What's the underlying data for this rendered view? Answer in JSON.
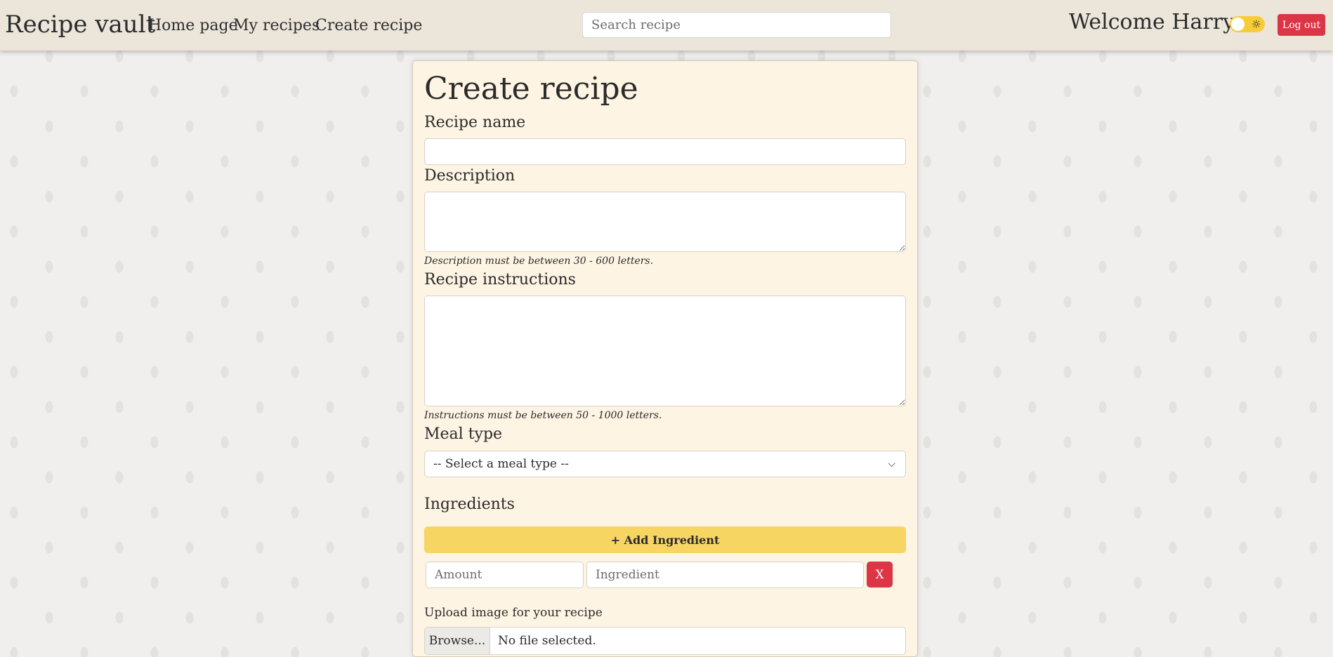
{
  "nav": {
    "brand": "Recipe vault",
    "links": [
      "Home page",
      "My recipes",
      "Create recipe"
    ],
    "search_placeholder": "Search recipe",
    "welcome": "Welcome Harry",
    "theme_toggle_icon": "sun-icon",
    "logout_label": "Log out"
  },
  "form": {
    "title": "Create recipe",
    "name_label": "Recipe name",
    "name_value": "",
    "description_label": "Description",
    "description_value": "",
    "description_hint": "Description must be between 30 - 600 letters.",
    "instructions_label": "Recipe instructions",
    "instructions_value": "",
    "instructions_hint": "Instructions must be between 50 - 1000 letters.",
    "meal_type_label": "Meal type",
    "meal_type_selected": "-- Select a meal type --",
    "ingredients_label": "Ingredients",
    "add_ingredient_label": "+ Add Ingredient",
    "ingredient_rows": [
      {
        "amount_placeholder": "Amount",
        "ingredient_placeholder": "Ingredient",
        "remove_label": "X"
      }
    ],
    "upload_label": "Upload image for your recipe",
    "browse_label": "Browse...",
    "file_status": "No file selected."
  },
  "colors": {
    "nav_bg": "#ebe5da",
    "card_bg": "#fdf4e3",
    "danger": "#dc3545",
    "warning": "#f7d563"
  }
}
